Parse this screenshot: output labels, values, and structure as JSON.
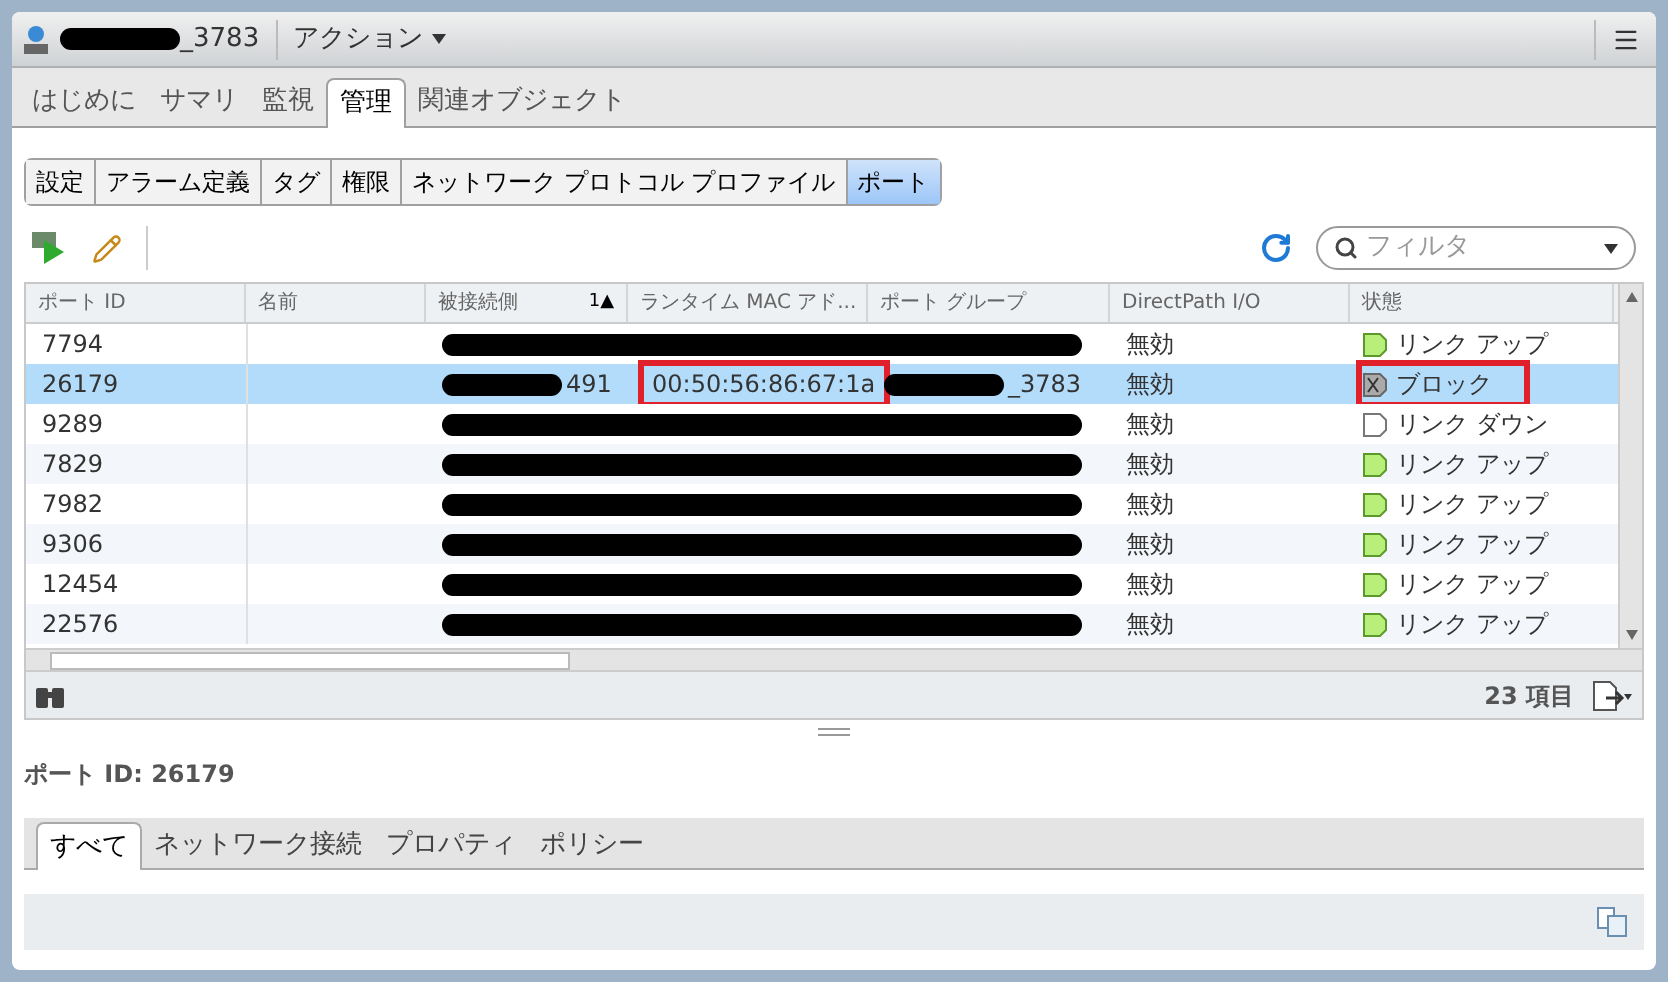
{
  "header": {
    "object_name": "_3783",
    "actions": "アクション"
  },
  "tabs": [
    {
      "label": "はじめに",
      "selected": false
    },
    {
      "label": "サマリ",
      "selected": false
    },
    {
      "label": "監視",
      "selected": false
    },
    {
      "label": "管理",
      "selected": true
    },
    {
      "label": "関連オブジェクト",
      "selected": false
    }
  ],
  "subtabs": [
    {
      "label": "設定",
      "selected": false
    },
    {
      "label": "アラーム定義",
      "selected": false
    },
    {
      "label": "タグ",
      "selected": false
    },
    {
      "label": "権限",
      "selected": false
    },
    {
      "label": "ネットワーク プロトコル プロファイル",
      "selected": false
    },
    {
      "label": "ポート",
      "selected": true
    }
  ],
  "filter": {
    "placeholder": "フィルタ"
  },
  "table": {
    "columns": [
      {
        "label": "ポート ID"
      },
      {
        "label": "名前"
      },
      {
        "label": "被接続側",
        "sort": "1▲"
      },
      {
        "label": "ランタイム MAC アド..."
      },
      {
        "label": "ポート グループ"
      },
      {
        "label": "DirectPath I/O"
      },
      {
        "label": "状態"
      }
    ],
    "rows": [
      {
        "port_id": "7794",
        "selected": false,
        "redacted": true,
        "directpath": "無効",
        "status": {
          "kind": "up",
          "text": "リンク アップ",
          "highlighted": false
        }
      },
      {
        "port_id": "26179",
        "selected": true,
        "redacted": false,
        "connectee": {
          "text": "491",
          "masked": true
        },
        "mac": {
          "text": "00:50:56:86:67:1a",
          "highlighted": true
        },
        "port_group": {
          "text": "_3783",
          "masked": true
        },
        "directpath": "無効",
        "status": {
          "kind": "blocked",
          "text": "ブロック",
          "highlighted": true
        }
      },
      {
        "port_id": "9289",
        "selected": false,
        "redacted": true,
        "directpath": "無効",
        "status": {
          "kind": "down",
          "text": "リンク ダウン",
          "highlighted": false
        }
      },
      {
        "port_id": "7829",
        "selected": false,
        "redacted": true,
        "directpath": "無効",
        "status": {
          "kind": "up",
          "text": "リンク アップ",
          "highlighted": false
        }
      },
      {
        "port_id": "7982",
        "selected": false,
        "redacted": true,
        "directpath": "無効",
        "status": {
          "kind": "up",
          "text": "リンク アップ",
          "highlighted": false
        }
      },
      {
        "port_id": "9306",
        "selected": false,
        "redacted": true,
        "directpath": "無効",
        "status": {
          "kind": "up",
          "text": "リンク アップ",
          "highlighted": false
        }
      },
      {
        "port_id": "12454",
        "selected": false,
        "redacted": true,
        "directpath": "無効",
        "status": {
          "kind": "up",
          "text": "リンク アップ",
          "highlighted": false
        }
      },
      {
        "port_id": "22576",
        "selected": false,
        "redacted": true,
        "directpath": "無効",
        "status": {
          "kind": "up",
          "text": "リンク アップ",
          "highlighted": false
        }
      }
    ],
    "count": "23 項目"
  },
  "details": {
    "title": "ポート ID: 26179",
    "tabs": [
      {
        "label": "すべて",
        "selected": true
      },
      {
        "label": "ネットワーク接続",
        "selected": false
      },
      {
        "label": "プロパティ",
        "selected": false
      },
      {
        "label": "ポリシー",
        "selected": false
      }
    ]
  }
}
